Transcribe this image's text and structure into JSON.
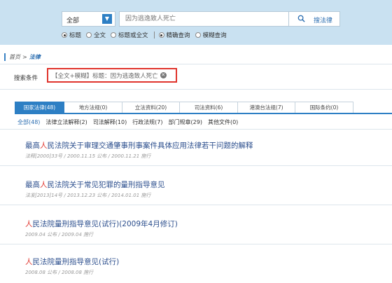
{
  "search": {
    "scope_value": "全部",
    "placeholder": "因为逃逸致人死亡",
    "button_label": "搜法律",
    "options": [
      "标题",
      "全文",
      "标题或全文",
      "精确查询",
      "模糊查询"
    ]
  },
  "breadcrumb": {
    "home": "首页",
    "separator": ">",
    "current": "法律"
  },
  "conditions": {
    "label": "搜索条件",
    "tag": "【全文+模糊】标题：因为逃逸致人死亡",
    "remove_icon": "close-circle-icon"
  },
  "tabs": [
    "国家法律(48)",
    "地方法规(0)",
    "立法资料(20)",
    "司法资料(6)",
    "港澳台法规(7)",
    "国际条约(0)"
  ],
  "subtabs": [
    "全部(48)",
    "法律立法解释(2)",
    "司法解释(10)",
    "行政法规(7)",
    "部门规章(29)",
    "其他文件(0)"
  ],
  "results": [
    {
      "pre": "最高",
      "hl": "人",
      "post": "民法院关于审理交通肇事刑事案件具体应用法律若干问题的解释",
      "meta": "法释[2000]33号 / 2000.11.15 公布 / 2000.11.21 施行"
    },
    {
      "pre": "最高",
      "hl": "人",
      "post": "民法院关于常见犯罪的量刑指导意见",
      "meta": "法发[2013]14号 / 2013.12.23 公布 / 2014.01.01 施行"
    },
    {
      "pre": "",
      "hl": "人",
      "post": "民法院量刑指导意见(试行)(2009年4月修订)",
      "meta": "2009.04 公布 / 2009.04 施行"
    },
    {
      "pre": "",
      "hl": "人",
      "post": "民法院量刑指导意见(试行)",
      "meta": "2008.08 公布 / 2008.08 施行"
    }
  ],
  "colors": {
    "accent": "#2d7fc4",
    "highlight": "#e0342d",
    "header_bg": "#c9e1f1",
    "link": "#2a4d8c"
  }
}
